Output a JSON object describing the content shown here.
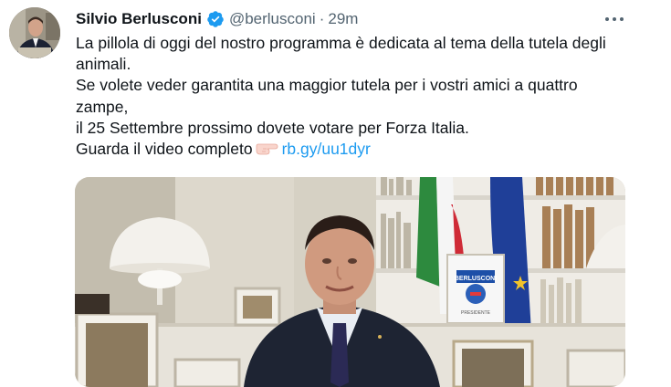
{
  "author": {
    "name": "Silvio Berlusconi",
    "handle": "@berlusconi",
    "separator": "·",
    "time": "29m",
    "verified": true
  },
  "tweet": {
    "lines": [
      "La pillola di oggi del nostro programma è dedicata al tema della tutela degli animali.",
      "Se volete veder garantita una maggior tutela per i vostri amici a quattro zampe,",
      "il 25 Settembre prossimo dovete votare per Forza Italia."
    ],
    "cta_text": "Guarda il video completo",
    "cta_icon": "backhand-pointing-right-icon",
    "link_text": "rb.gy/uu1dyr"
  },
  "media": {
    "poster_sign_text": "BERLUSCONI",
    "poster_sign_subtext": "PRESIDENTE"
  },
  "colors": {
    "link": "#1d9bf0",
    "verified_badge": "#1d9bf0",
    "secondary_text": "#536471",
    "primary_text": "#0f1419"
  }
}
